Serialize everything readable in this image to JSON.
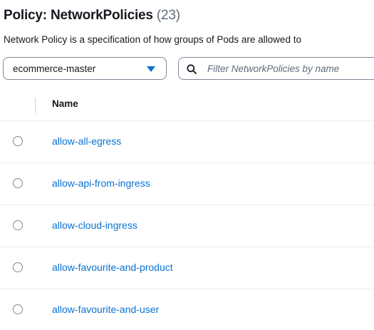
{
  "header": {
    "title": "Policy: NetworkPolicies",
    "count": "(23)",
    "description": "Network Policy is a specification of how groups of Pods are allowed to"
  },
  "namespace_select": {
    "value": "ecommerce-master",
    "caret_icon": "caret-down-icon",
    "caret_color": "#0972d3"
  },
  "filter": {
    "placeholder": "Filter NetworkPolicies by name",
    "value": "",
    "icon": "search-icon"
  },
  "table": {
    "columns": [
      {
        "label": "Name"
      }
    ],
    "rows": [
      {
        "name": "allow-all-egress"
      },
      {
        "name": "allow-api-from-ingress"
      },
      {
        "name": "allow-cloud-ingress"
      },
      {
        "name": "allow-favourite-and-product"
      },
      {
        "name": "allow-favourite-and-user"
      }
    ]
  },
  "colors": {
    "link": "#0972d3",
    "text": "#16191f",
    "muted": "#5f6b7a",
    "border": "#7d8998",
    "divider": "#e9ebed"
  }
}
